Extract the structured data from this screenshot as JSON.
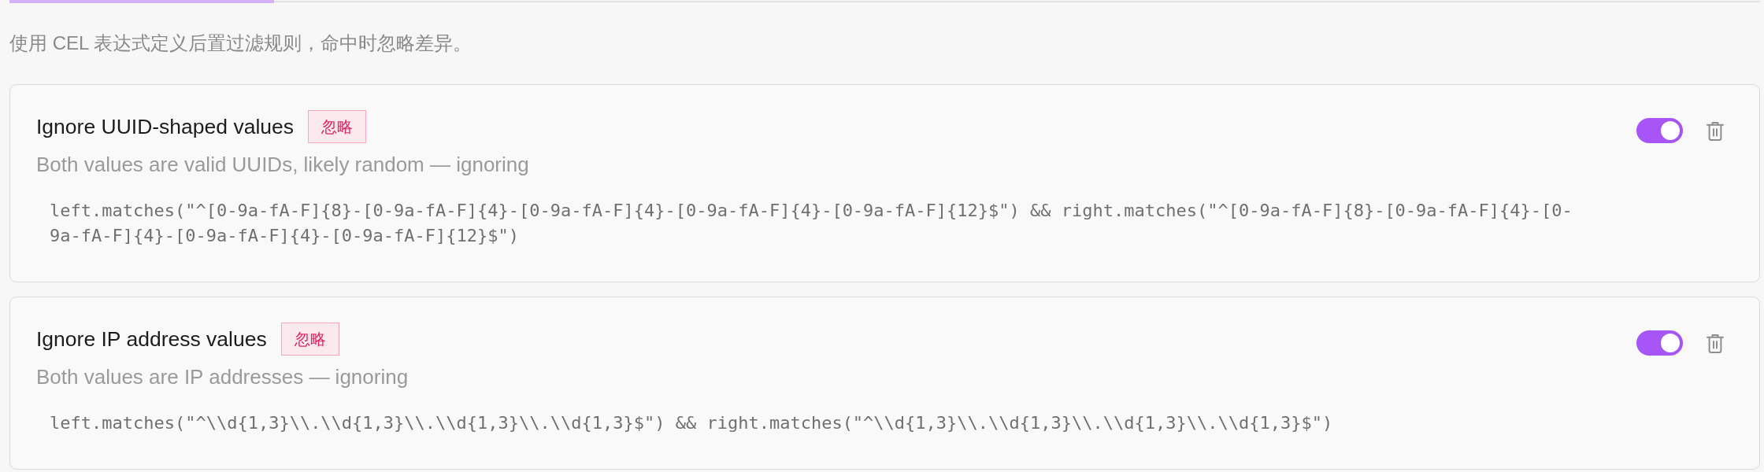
{
  "description": "使用 CEL 表达式定义后置过滤规则，命中时忽略差异。",
  "rules": [
    {
      "name": "Ignore UUID-shaped values",
      "badge": "忽略",
      "reason": "Both values are valid UUIDs, likely random — ignoring",
      "expression": "left.matches(\"^[0-9a-fA-F]{8}-[0-9a-fA-F]{4}-[0-9a-fA-F]{4}-[0-9a-fA-F]{4}-[0-9a-fA-F]{12}$\") && right.matches(\"^[0-9a-fA-F]{8}-[0-9a-fA-F]{4}-[0-9a-fA-F]{4}-[0-9a-fA-F]{4}-[0-9a-fA-F]{12}$\")",
      "enabled": true
    },
    {
      "name": "Ignore IP address values",
      "badge": "忽略",
      "reason": "Both values are IP addresses — ignoring",
      "expression": "left.matches(\"^\\\\d{1,3}\\\\.\\\\d{1,3}\\\\.\\\\d{1,3}\\\\.\\\\d{1,3}$\") && right.matches(\"^\\\\d{1,3}\\\\.\\\\d{1,3}\\\\.\\\\d{1,3}\\\\.\\\\d{1,3}$\")",
      "enabled": true
    }
  ]
}
